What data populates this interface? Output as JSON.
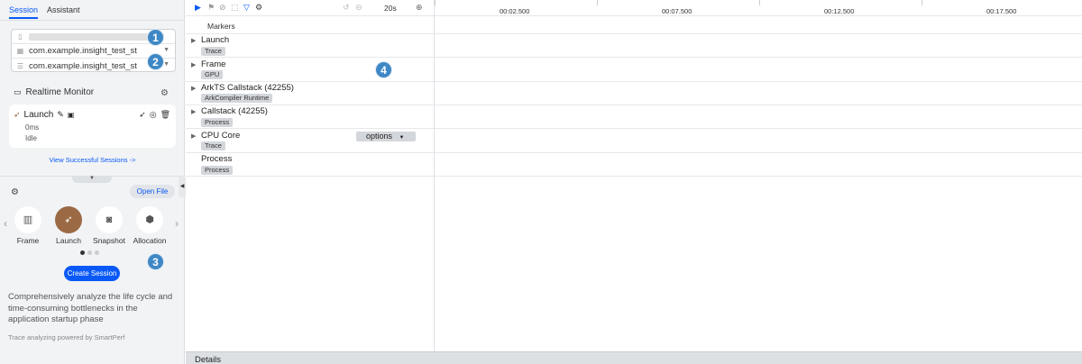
{
  "tabs": [
    {
      "label": "Session"
    },
    {
      "label": "Assistant"
    }
  ],
  "selectors": {
    "device_value": "",
    "app_value_1": "com.example.insight_test_st",
    "app_value_2": "com.example.insight_test_st"
  },
  "badges": [
    "1",
    "2",
    "3",
    "4"
  ],
  "realtime": {
    "title": "Realtime Monitor",
    "card": {
      "title": "Launch",
      "duration": "0ms",
      "status": "Idle"
    }
  },
  "view_sessions_link": "View Successful Sessions ->",
  "open_file_label": "Open File",
  "tools": [
    {
      "label": "Frame",
      "icon": "frame-icon"
    },
    {
      "label": "Launch",
      "icon": "rocket-icon",
      "selected": true
    },
    {
      "label": "Snapshot",
      "icon": "camera-icon"
    },
    {
      "label": "Allocation",
      "icon": "cube-icon"
    }
  ],
  "create_session_label": "Create Session",
  "description": "Comprehensively analyze the life cycle and time-consuming bottlenecks in the application startup phase",
  "powered_by": "Trace analyzing powered by SmartPerf",
  "timeline": {
    "zoom": "20s",
    "markers_label": "Markers",
    "ticks": [
      "00:02.500",
      "00:07.500",
      "00:12.500",
      "00:17.500"
    ]
  },
  "tracks": [
    {
      "title": "Launch",
      "tag": "Trace",
      "expandable": true
    },
    {
      "title": "Frame",
      "tag": "GPU",
      "expandable": true
    },
    {
      "title": "ArkTS Callstack (42255)",
      "tag": "ArkCompiler Runtime",
      "expandable": true
    },
    {
      "title": "Callstack (42255)",
      "tag": "Process",
      "expandable": true
    },
    {
      "title": "CPU Core",
      "tag": "Trace",
      "expandable": true
    },
    {
      "title": "Process",
      "tag": "Process",
      "expandable": false
    }
  ],
  "options_label": "options",
  "details_label": "Details",
  "colors": {
    "accent": "#0a59f7",
    "badge": "#3f88c6",
    "launch_tool": "#9b6a45"
  }
}
